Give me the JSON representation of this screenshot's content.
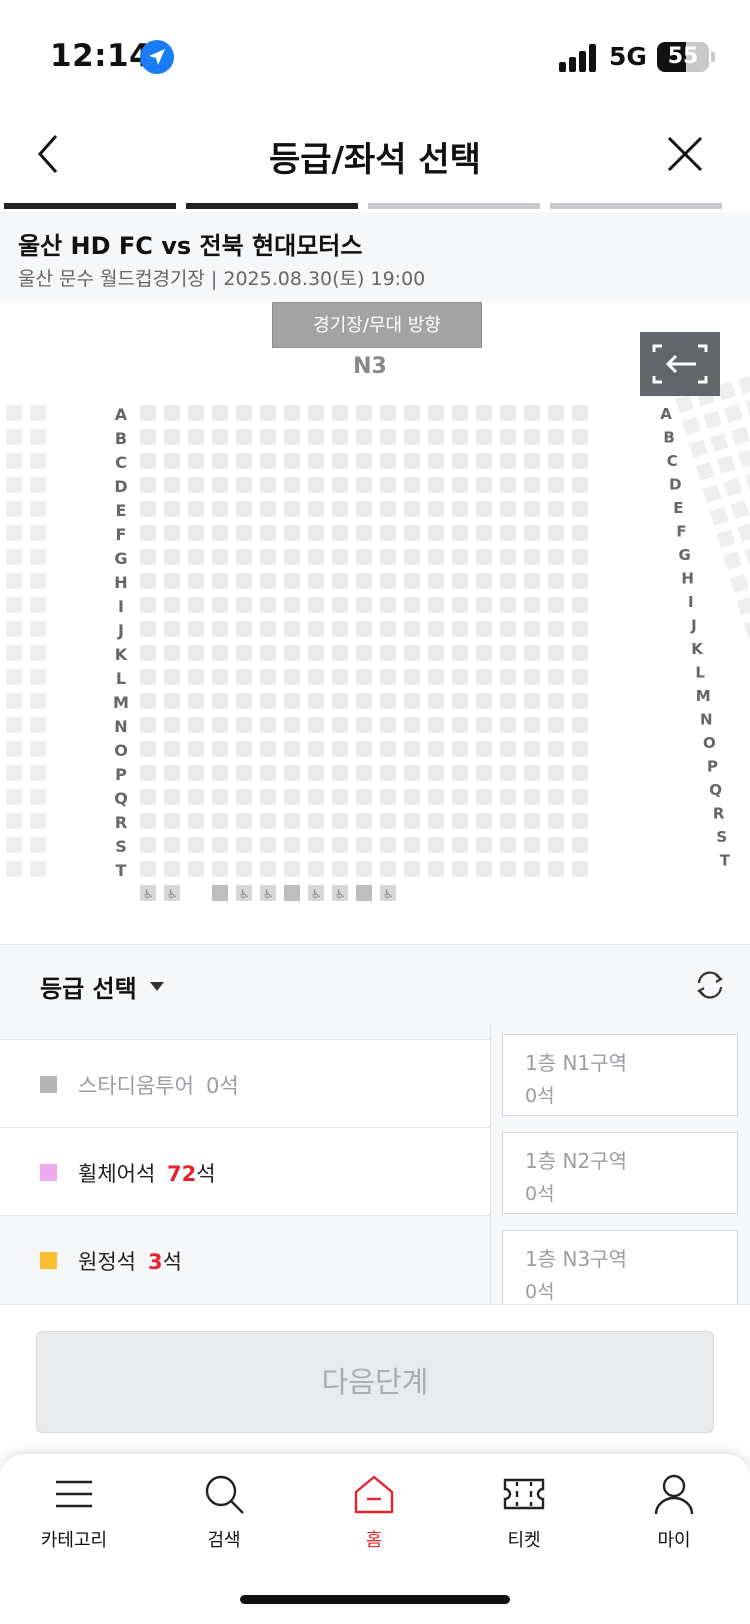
{
  "status_bar": {
    "time": "12:14",
    "network": "5G",
    "battery": "55",
    "battery_fraction": 0.55
  },
  "header": {
    "title": "등급/좌석 선택"
  },
  "steps": {
    "total": 4,
    "completed": 2
  },
  "event": {
    "title": "울산 HD FC vs 전북 현대모터스",
    "venue_datetime": "울산 문수 월드컵경기장 | 2025.08.30(토) 19:00"
  },
  "seatmap": {
    "stage_label": "경기장/무대 방향",
    "section": "N3",
    "row_labels": [
      "A",
      "B",
      "C",
      "D",
      "E",
      "F",
      "G",
      "H",
      "I",
      "J",
      "K",
      "L",
      "M",
      "N",
      "O",
      "P",
      "Q",
      "R",
      "S",
      "T"
    ],
    "wheelchair_symbol": "♿",
    "seat_colors": {
      "main": "#ebebeb",
      "side": "#eeeeee",
      "wheelchair": "#d6d6d6",
      "wheelchair_filled": "#bdbdbd"
    }
  },
  "grade_select": {
    "title": "등급 선택"
  },
  "grades": [
    {
      "name": "스타디움투어",
      "count": "0",
      "unit": "석",
      "color": "#b5b5b5",
      "name_color": "#9a9ea4",
      "count_color": "#9a9ea4"
    },
    {
      "name": "휠체어석",
      "count": "72",
      "unit": "석",
      "color": "#eeaaee",
      "name_color": "#222222",
      "count_color": "#e5242e"
    },
    {
      "name": "원정석",
      "count": "3",
      "unit": "석",
      "color": "#f8c030",
      "name_color": "#222222",
      "count_color": "#e5242e"
    }
  ],
  "zones": [
    {
      "name": "1층 N1구역",
      "count": "0석"
    },
    {
      "name": "1층 N2구역",
      "count": "0석"
    },
    {
      "name": "1층 N3구역",
      "count": "0석"
    }
  ],
  "next_button": {
    "label": "다음단계"
  },
  "tabs": [
    {
      "label": "카테고리",
      "icon": "menu-icon",
      "active": false
    },
    {
      "label": "검색",
      "icon": "search-icon",
      "active": false
    },
    {
      "label": "홈",
      "icon": "home-icon",
      "active": true
    },
    {
      "label": "티켓",
      "icon": "ticket-icon",
      "active": false
    },
    {
      "label": "마이",
      "icon": "user-icon",
      "active": false
    }
  ],
  "colors": {
    "accent": "#e5242e",
    "location": "#1a7cf5",
    "step_active": "#222222",
    "step_inactive": "#c9cbce"
  }
}
